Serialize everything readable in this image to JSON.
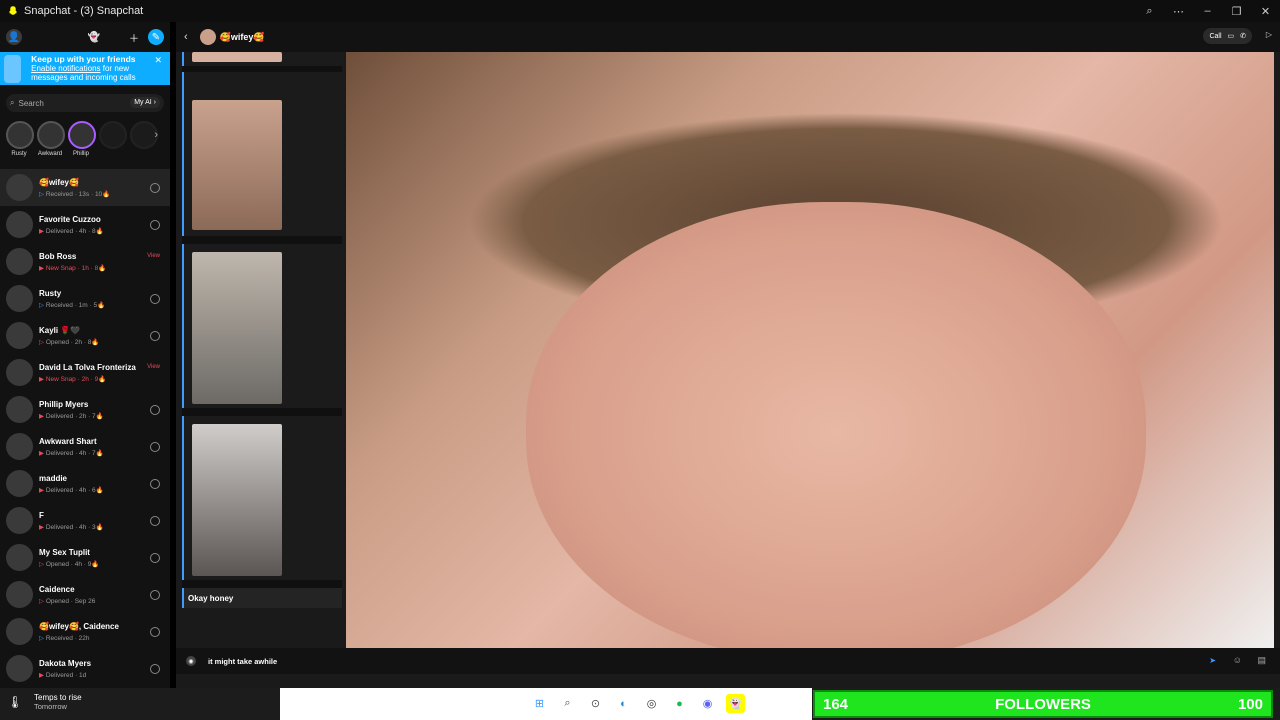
{
  "window": {
    "title": "Snapchat - (3) Snapchat"
  },
  "sidebar": {
    "banner": {
      "title": "Keep up with your friends",
      "link": "Enable notifications",
      "text": " for new messages and incoming calls"
    },
    "search": {
      "placeholder": "Search",
      "myai": "My AI"
    },
    "stories": [
      {
        "name": "Rusty"
      },
      {
        "name": "Awkward"
      },
      {
        "name": "Phillip"
      }
    ],
    "chats": [
      {
        "name": "🥰wifey🥰",
        "status": "Received · 13s · 10🔥",
        "kind": "received"
      },
      {
        "name": "Favorite Cuzzoo",
        "status": "Delivered · 4h · 8🔥",
        "kind": "delivered"
      },
      {
        "name": "Bob Ross",
        "status": "New Snap · 1h · 8🔥",
        "kind": "new",
        "action": "View"
      },
      {
        "name": "Rusty",
        "status": "Received · 1m · 5🔥",
        "kind": "received"
      },
      {
        "name": "Kayli 🌹🖤",
        "status": "Opened · 2h · 8🔥",
        "kind": "opened"
      },
      {
        "name": "David La Tolva Fronteriza",
        "status": "New Snap · 2h · 9🔥",
        "kind": "new",
        "action": "View"
      },
      {
        "name": "Phillip Myers",
        "status": "Delivered · 2h · 7🔥",
        "kind": "delivered"
      },
      {
        "name": "Awkward Shart",
        "status": "Delivered · 4h · 7🔥",
        "kind": "delivered"
      },
      {
        "name": "maddie",
        "status": "Delivered · 4h · 6🔥",
        "kind": "delivered"
      },
      {
        "name": "F",
        "status": "Delivered · 4h · 3🔥",
        "kind": "delivered"
      },
      {
        "name": "My Sex Tuplit",
        "status": "Opened · 4h · 9🔥",
        "kind": "opened"
      },
      {
        "name": "Caidence",
        "status": "Opened · Sep 26",
        "kind": "opened"
      },
      {
        "name": "🥰wifey🥰, Caidence",
        "status": "Received · 22h",
        "kind": "received"
      },
      {
        "name": "Dakota Myers",
        "status": "Delivered · 1d",
        "kind": "delivered"
      }
    ]
  },
  "chat": {
    "header_name": "🥰wifey🥰",
    "call_label": "Call",
    "last_message": "Okay honey",
    "composer_value": "it might take awhile"
  },
  "taskbar": {
    "weather_line1": "Temps to rise",
    "weather_line2": "Tomorrow"
  },
  "overlay": {
    "left": "164",
    "label": "FOLLOWERS",
    "right": "100"
  },
  "colors": {
    "accent": "#0fadff",
    "red": "#e64a5a",
    "blue": "#3e9cff",
    "green": "#1fe51f"
  }
}
